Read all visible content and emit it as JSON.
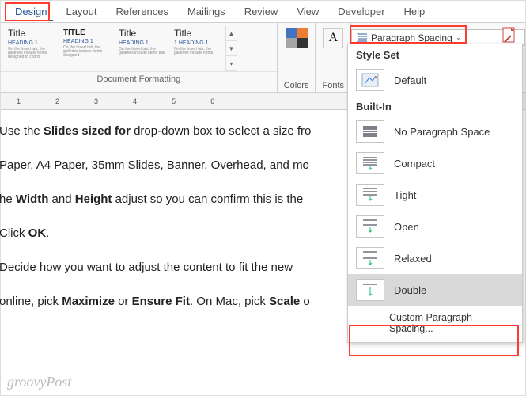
{
  "tabs": {
    "design": "Design",
    "layout": "Layout",
    "references": "References",
    "mailings": "Mailings",
    "review": "Review",
    "view": "View",
    "developer": "Developer",
    "help": "Help"
  },
  "ribbon": {
    "doc_formatting_label": "Document Formatting",
    "colors_label": "Colors",
    "fonts_label": "Fonts",
    "paragraph_spacing_label": "Paragraph Spacing",
    "style_tiles": {
      "t1": {
        "title": "Title",
        "heading": "Heading 1"
      },
      "t2": {
        "title": "TITLE",
        "heading": "HEADING 1"
      },
      "t3": {
        "title": "Title",
        "heading": "Heading 1"
      },
      "t4": {
        "title": "Title",
        "heading": "1 Heading 1"
      }
    }
  },
  "ruler": {
    "n1": "1",
    "n2": "2",
    "n3": "3",
    "n4": "4",
    "n5": "5",
    "n6": "6"
  },
  "doc": {
    "p1a": "Use the ",
    "p1b": "Slides sized for",
    "p1c": " drop-down box to select a size fro",
    "p2": "Paper, A4 Paper, 35mm Slides, Banner, Overhead, and mo",
    "p3a": "he ",
    "p3b": "Width",
    "p3c": " and ",
    "p3d": "Height",
    "p3e": " adjust so you can confirm this is the",
    "p4a": "Click ",
    "p4b": "OK",
    "p4c": ".",
    "p5": "Decide how you want to adjust the content to fit the new",
    "p6a": "online, pick ",
    "p6b": "Maximize",
    "p6c": " or ",
    "p6d": "Ensure Fit",
    "p6e": ". On Mac, pick ",
    "p6f": "Scale",
    "p6g": " o"
  },
  "dropdown": {
    "style_set": "Style Set",
    "default": "Default",
    "built_in": "Built-In",
    "no_para": "No Paragraph Space",
    "compact": "Compact",
    "tight": "Tight",
    "open": "Open",
    "relaxed": "Relaxed",
    "double": "Double",
    "custom": "Custom Paragraph Spacing..."
  },
  "watermark": "groovyPost"
}
